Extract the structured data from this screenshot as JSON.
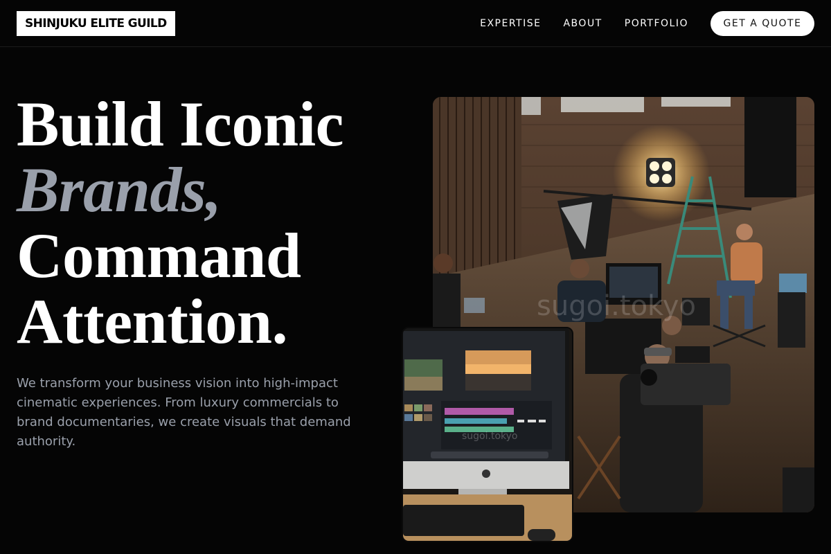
{
  "header": {
    "logo": "SHINJUKU ELITE GUILD",
    "nav": [
      "EXPERTISE",
      "ABOUT",
      "PORTFOLIO"
    ],
    "cta": "GET A QUOTE"
  },
  "hero": {
    "line1": "Build Iconic",
    "line2": "Brands,",
    "line3": "Command",
    "line4": "Attention.",
    "description": "We transform your business vision into high-impact cinematic experiences. From luxury commercials to brand documentaries, we create visuals that demand authority."
  },
  "images": {
    "main_watermark": "sugoi.tokyo",
    "inset_watermark": "sugoi.tokyo"
  },
  "colors": {
    "background": "#050505",
    "accent_text": "#9aa0ab",
    "button_bg": "#ffffff"
  }
}
